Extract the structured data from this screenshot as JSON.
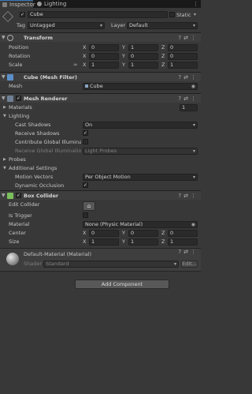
{
  "tabs": [
    {
      "label": "Inspector",
      "icon": "info-icon",
      "active": true
    },
    {
      "label": "Lighting",
      "icon": "lightbulb-icon",
      "active": false
    }
  ],
  "gameobject": {
    "name": "Cube",
    "static_label": "Static",
    "tag_label": "Tag",
    "tag_value": "Untagged",
    "layer_label": "Layer",
    "layer_value": "Default"
  },
  "transform": {
    "title": "Transform",
    "position_label": "Position",
    "rotation_label": "Rotation",
    "scale_label": "Scale",
    "axes": [
      "X",
      "Y",
      "Z"
    ],
    "position": [
      "0",
      "1",
      "0"
    ],
    "rotation": [
      "0",
      "0",
      "0"
    ],
    "scale": [
      "1",
      "1",
      "1"
    ]
  },
  "mesh_filter": {
    "title": "Cube (Mesh Filter)",
    "mesh_label": "Mesh",
    "mesh_value": "Cube"
  },
  "mesh_renderer": {
    "title": "Mesh Renderer",
    "materials_label": "Materials",
    "materials_count": "1",
    "lighting_label": "Lighting",
    "cast_shadows_label": "Cast Shadows",
    "cast_shadows_value": "On",
    "receive_shadows_label": "Receive Shadows",
    "contribute_gi_label": "Contribute Global Illumination",
    "receive_gi_label": "Receive Global Illumination",
    "receive_gi_value": "Light Probes",
    "probes_label": "Probes",
    "additional_label": "Additional Settings",
    "motion_vectors_label": "Motion Vectors",
    "motion_vectors_value": "Per Object Motion",
    "dynamic_occlusion_label": "Dynamic Occlusion"
  },
  "box_collider": {
    "title": "Box Collider",
    "edit_collider_label": "Edit Collider",
    "is_trigger_label": "Is Trigger",
    "material_label": "Material",
    "material_value": "None (Physic Material)",
    "center_label": "Center",
    "size_label": "Size",
    "center": [
      "0",
      "0",
      "0"
    ],
    "size": [
      "1",
      "1",
      "1"
    ]
  },
  "material": {
    "name": "Default-Material (Material)",
    "shader_label": "Shader",
    "shader_value": "Standard",
    "edit_label": "Edit..."
  },
  "add_component_label": "Add Component",
  "colors": {
    "panel_bg": "#383838",
    "tab_bar_bg": "#191919",
    "accent_blue": "#3a79bb",
    "component_header_bg": "#3e3e3e"
  }
}
